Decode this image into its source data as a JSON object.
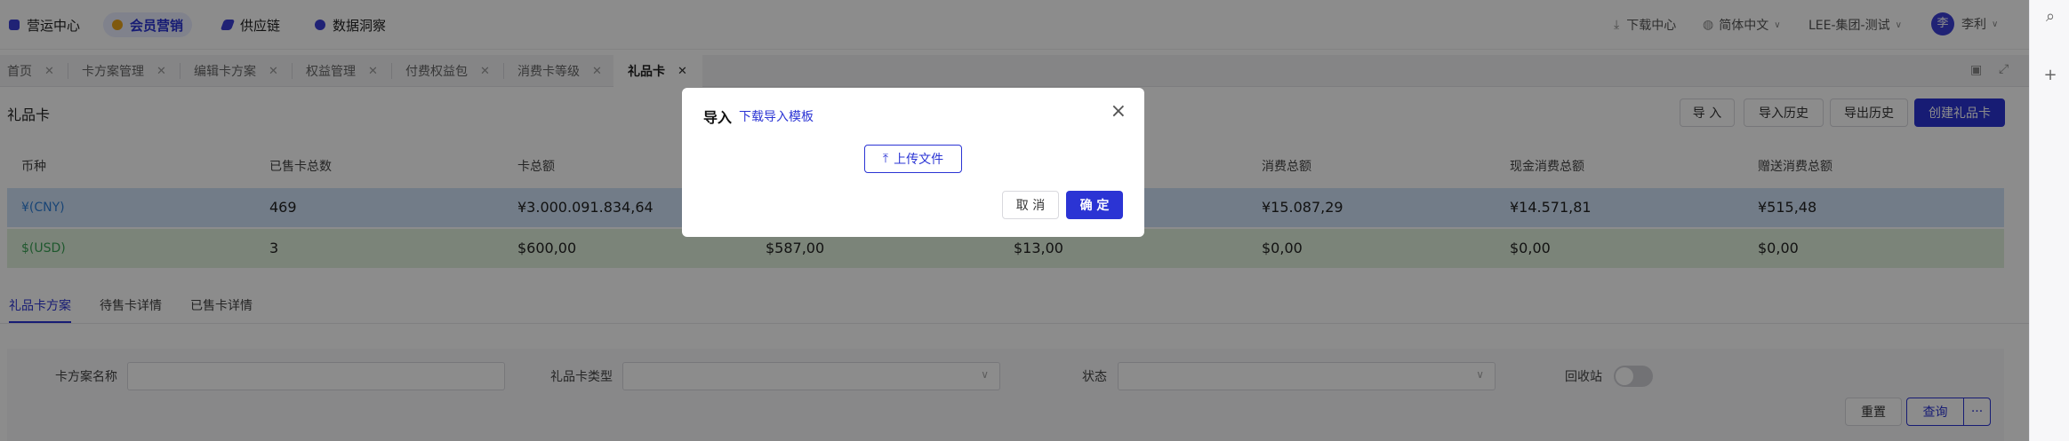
{
  "topnav": {
    "items": [
      {
        "label": "营运中心",
        "color": "#3b3fd6"
      },
      {
        "label": "会员营销",
        "color": "#e8a21a"
      },
      {
        "label": "供应链",
        "color": "#3b3fd6"
      },
      {
        "label": "数据洞察",
        "color": "#3b3fd6"
      }
    ],
    "download_center": "下载中心",
    "language": "简体中文",
    "org": "LEE-集团-测试",
    "user_avatar": "李",
    "user_name": "李利"
  },
  "tabs": [
    {
      "label": "首页"
    },
    {
      "label": "卡方案管理"
    },
    {
      "label": "编辑卡方案"
    },
    {
      "label": "权益管理"
    },
    {
      "label": "付费权益包"
    },
    {
      "label": "消费卡等级"
    },
    {
      "label": "礼品卡"
    }
  ],
  "page": {
    "title": "礼品卡",
    "buttons": {
      "import": "导 入",
      "import_history": "导入历史",
      "export_history": "导出历史",
      "create": "创建礼品卡"
    }
  },
  "summary": {
    "headers": [
      "币种",
      "已售卡总数",
      "卡总额",
      "",
      "",
      "消费总额",
      "现金消费总额",
      "赠送消费总额"
    ],
    "rows": [
      {
        "cells": [
          "¥(CNY)",
          "469",
          "¥3.000.091.834,64",
          "",
          "",
          "¥15.087,29",
          "¥14.571,81",
          "¥515,48"
        ],
        "bg": "#cfe2f7",
        "currency_color": "#2f7fd8"
      },
      {
        "cells": [
          "$(USD)",
          "3",
          "$600,00",
          "$587,00",
          "$13,00",
          "$0,00",
          "$0,00",
          "$0,00"
        ],
        "bg": "#e1f0dc",
        "currency_color": "#3aa155"
      }
    ]
  },
  "subtabs": [
    "礼品卡方案",
    "待售卡详情",
    "已售卡详情"
  ],
  "filter": {
    "name_label": "卡方案名称",
    "type_label": "礼品卡类型",
    "status_label": "状态",
    "recycle_label": "回收站",
    "reset": "重置",
    "search": "查询",
    "more": "···"
  },
  "modal": {
    "title": "导入",
    "template_link": "下载导入模板",
    "upload": "上传文件",
    "cancel": "取 消",
    "confirm": "确 定"
  }
}
